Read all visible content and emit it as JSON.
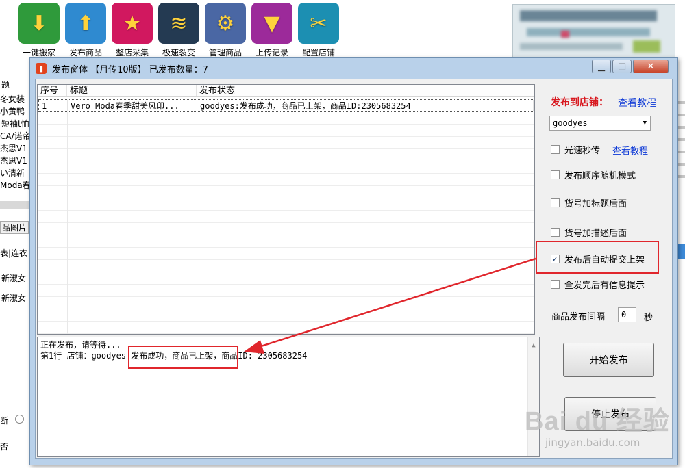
{
  "toolbar": {
    "items": [
      {
        "label": "一键搬家",
        "icon": "cloud-download-icon",
        "color": "#2f9a3b"
      },
      {
        "label": "发布商品",
        "icon": "cloud-upload-icon",
        "color": "#2f8ad0"
      },
      {
        "label": "整店采集",
        "icon": "star-icon",
        "color": "#d1185f"
      },
      {
        "label": "极速裂变",
        "icon": "layers-icon",
        "color": "#243a52"
      },
      {
        "label": "管理商品",
        "icon": "gear-icon",
        "color": "#4a67a4"
      },
      {
        "label": "上传记录",
        "icon": "bookmark-icon",
        "color": "#9c2a9a"
      },
      {
        "label": "配置店铺",
        "icon": "tools-icon",
        "color": "#1c8fb2"
      }
    ]
  },
  "background": {
    "left_texts": [
      "题",
      "冬女装",
      "小黄鸭",
      "短袖t恤",
      "CA/诺帝",
      "杰思V1",
      "杰思V1",
      "い清新",
      "Moda春",
      "品图片",
      "表|连衣",
      "新淑女",
      "新淑女",
      "断",
      "否"
    ]
  },
  "window": {
    "title": "发布窗体 【月传10版】 已发布数量：7",
    "table": {
      "columns": [
        "序号",
        "标题",
        "发布状态"
      ],
      "rows": [
        {
          "no": "1",
          "title": "Vero Moda春季甜美风印...",
          "status": "goodyes:发布成功，商品已上架，商品ID:2305683254"
        }
      ]
    },
    "log": {
      "lines": [
        "正在发布，请等待...",
        "第1行 店铺：goodyes 发布成功，商品已上架，商品ID: 2305683254"
      ]
    },
    "right": {
      "publish_to_label": "发布到店铺：",
      "tutorial_link": "查看教程",
      "store_select": "goodyes",
      "options": [
        {
          "label": "光速秒传",
          "checked": false,
          "link": "查看教程"
        },
        {
          "label": "发布顺序随机模式",
          "checked": false
        },
        {
          "label": "货号加标题后面",
          "checked": false
        },
        {
          "label": "货号加描述后面",
          "checked": false
        },
        {
          "label": "发布后自动提交上架",
          "checked": true
        },
        {
          "label": "全发完后有信息提示",
          "checked": false
        }
      ],
      "interval_label": "商品发布间隔",
      "interval_value": "0",
      "interval_unit": "秒",
      "start_button": "开始发布",
      "stop_button": "停止发布"
    }
  },
  "watermark": {
    "text": "Bai du 经验",
    "url": "jingyan.baidu.com"
  },
  "colors": {
    "highlight": "#e0262c",
    "link": "#0b37d6",
    "red_label": "#d8181f"
  }
}
